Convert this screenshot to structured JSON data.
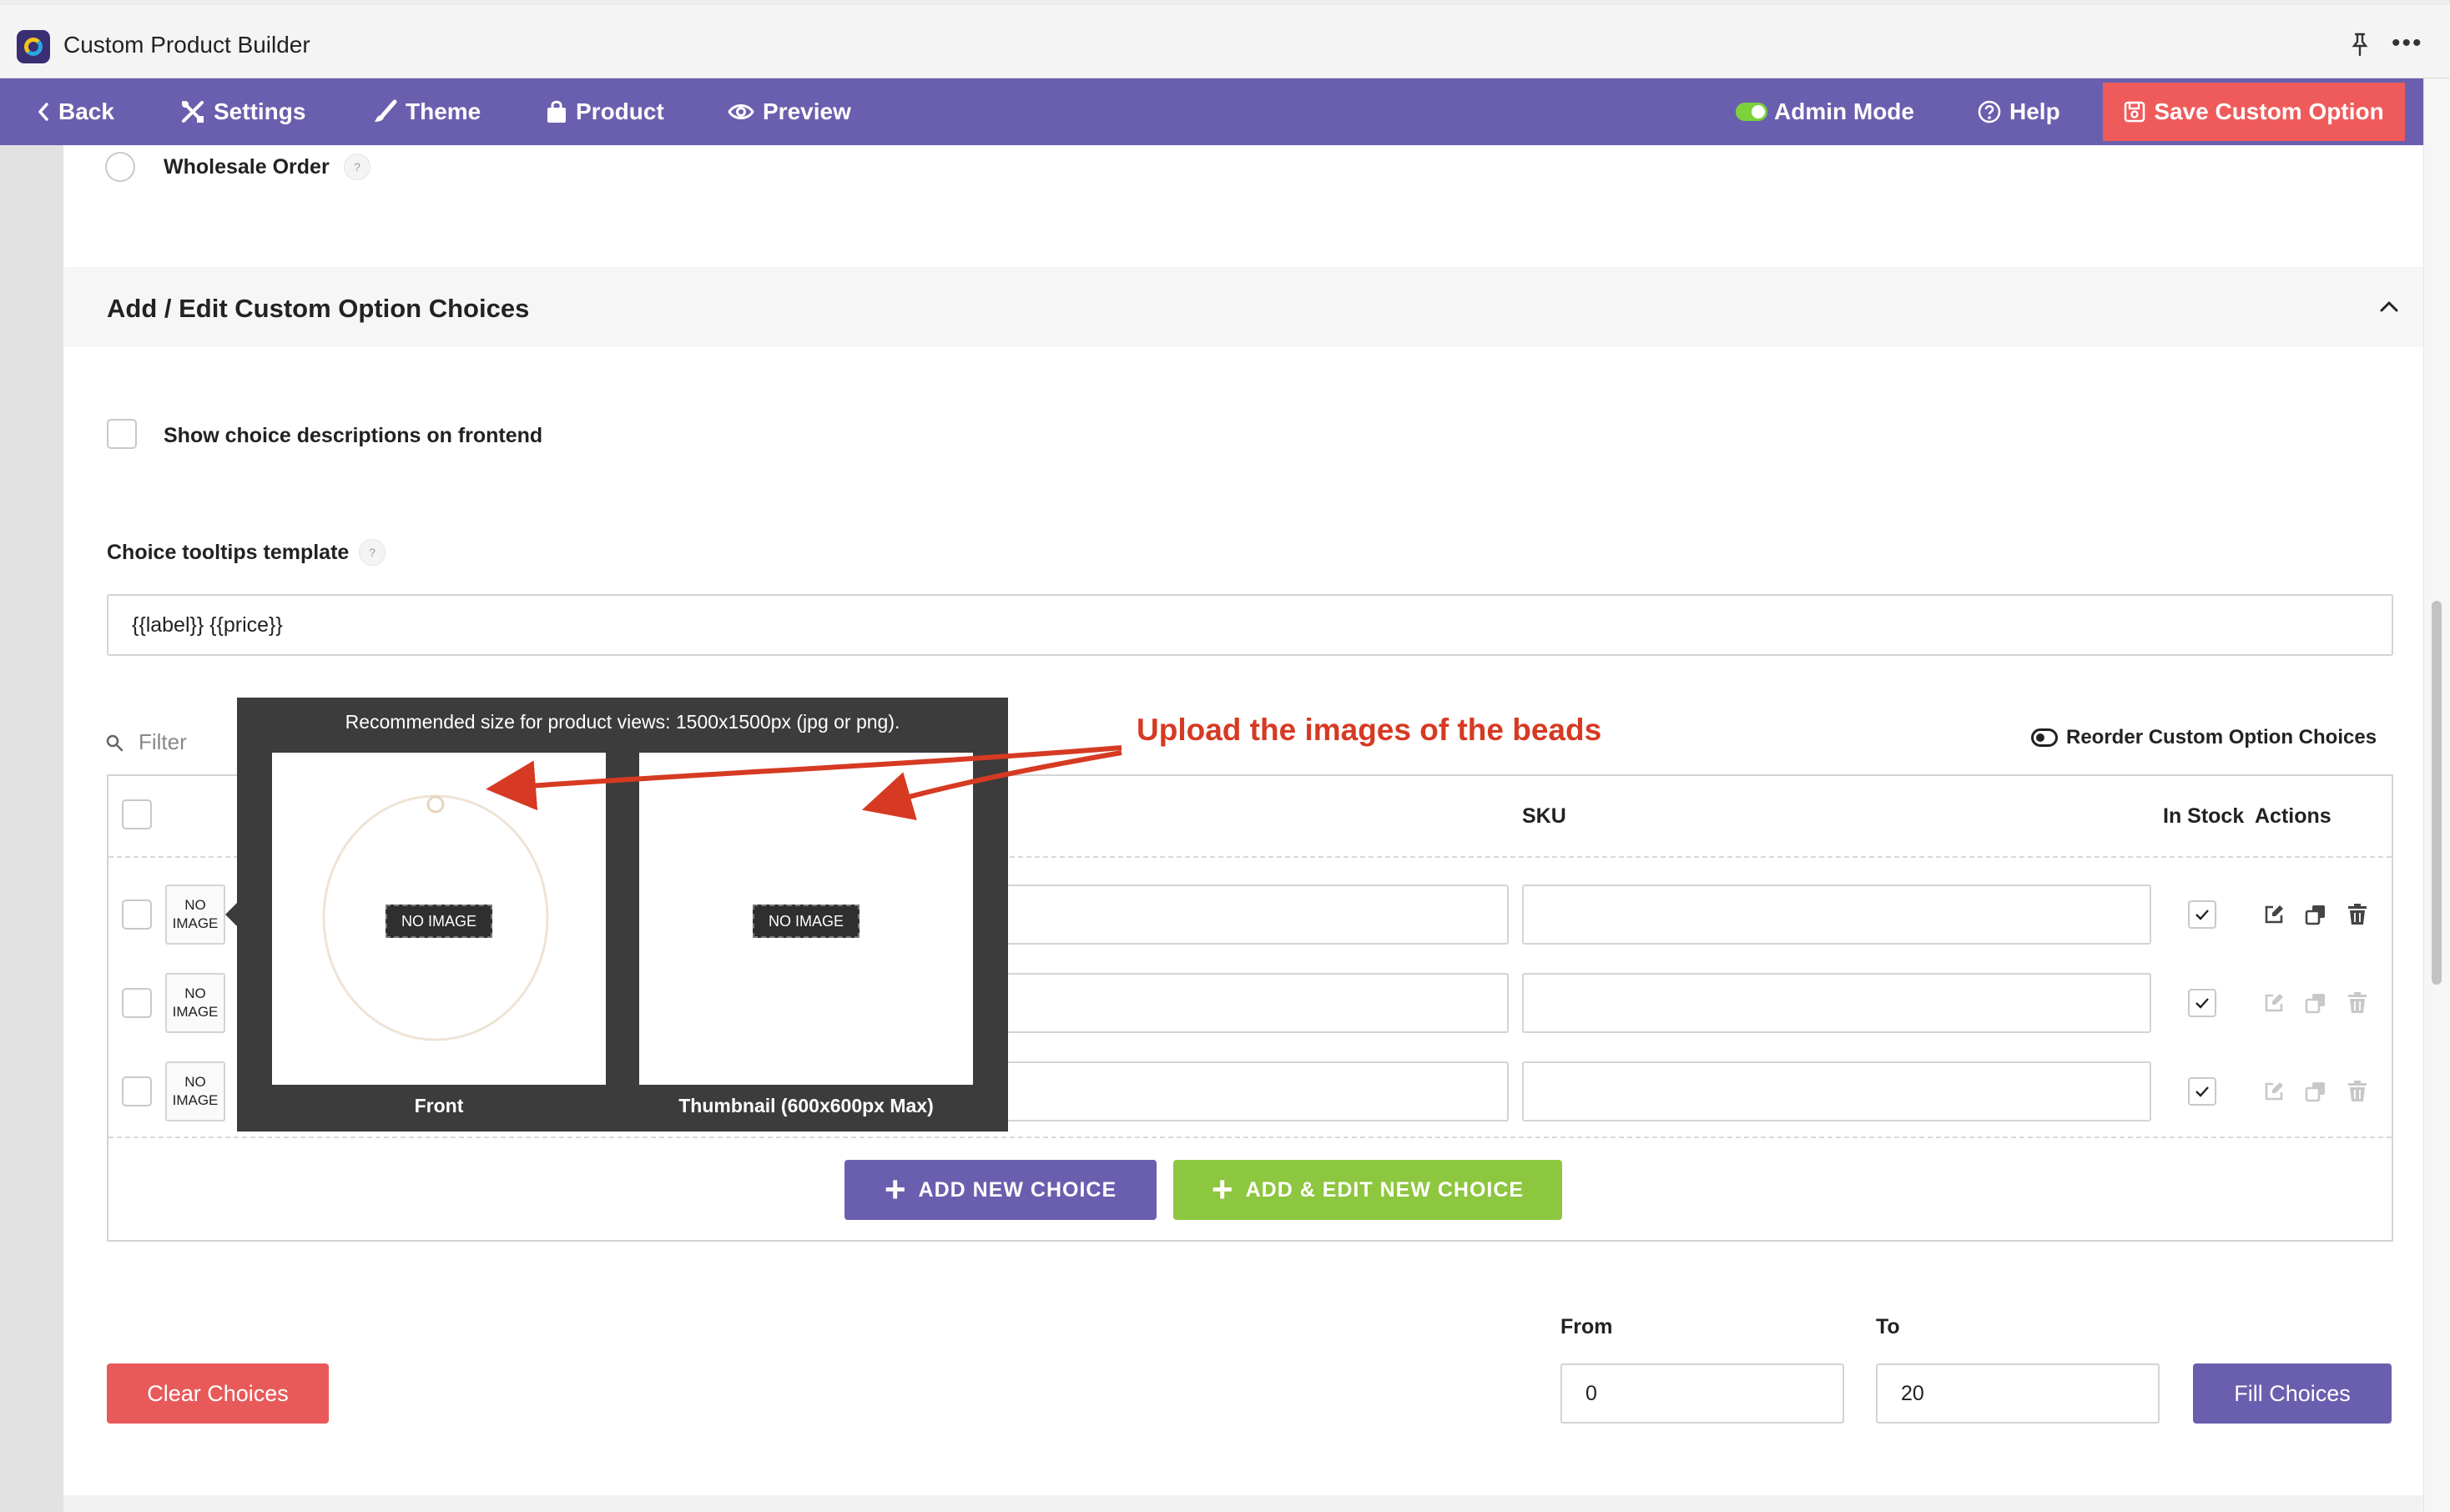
{
  "app": {
    "title": "Custom Product Builder"
  },
  "toolbar": {
    "back_label": "Back",
    "settings_label": "Settings",
    "theme_label": "Theme",
    "product_label": "Product",
    "preview_label": "Preview",
    "admin_mode_label": "Admin Mode",
    "help_label": "Help",
    "save_label": "Save Custom Option"
  },
  "form": {
    "wholesale_label": "Wholesale Order",
    "section_title": "Add / Edit Custom Option Choices",
    "show_descriptions_label": "Show choice descriptions on frontend",
    "tooltip_template_label": "Choice tooltips template",
    "tooltip_template_value": "{{label}} {{price}}"
  },
  "choices": {
    "filter_placeholder": "Filter",
    "reorder_label": "Reorder Custom Option Choices",
    "columns": {
      "sku": "SKU",
      "in_stock": "In Stock",
      "actions": "Actions"
    },
    "no_image_label": "NO IMAGE",
    "rows": [
      {
        "in_stock": true
      },
      {
        "in_stock": true
      },
      {
        "in_stock": true
      }
    ],
    "add_new_label": "ADD NEW CHOICE",
    "add_edit_label": "ADD & EDIT NEW CHOICE"
  },
  "image_popover": {
    "title": "Recommended size for product views: 1500x1500px (jpg or png).",
    "front_caption": "Front",
    "thumbnail_caption": "Thumbnail (600x600px Max)",
    "no_image_tag": "NO IMAGE"
  },
  "annotation": {
    "text": "Upload the images of the beads",
    "color": "#d63a22"
  },
  "fill": {
    "clear_label": "Clear Choices",
    "from_label": "From",
    "from_value": "0",
    "to_label": "To",
    "to_value": "20",
    "fill_label": "Fill Choices"
  },
  "colors": {
    "toolbar": "#6a5fae",
    "save": "#ef5b5b",
    "clear": "#e85a5a",
    "add_edit": "#8dc63f"
  }
}
